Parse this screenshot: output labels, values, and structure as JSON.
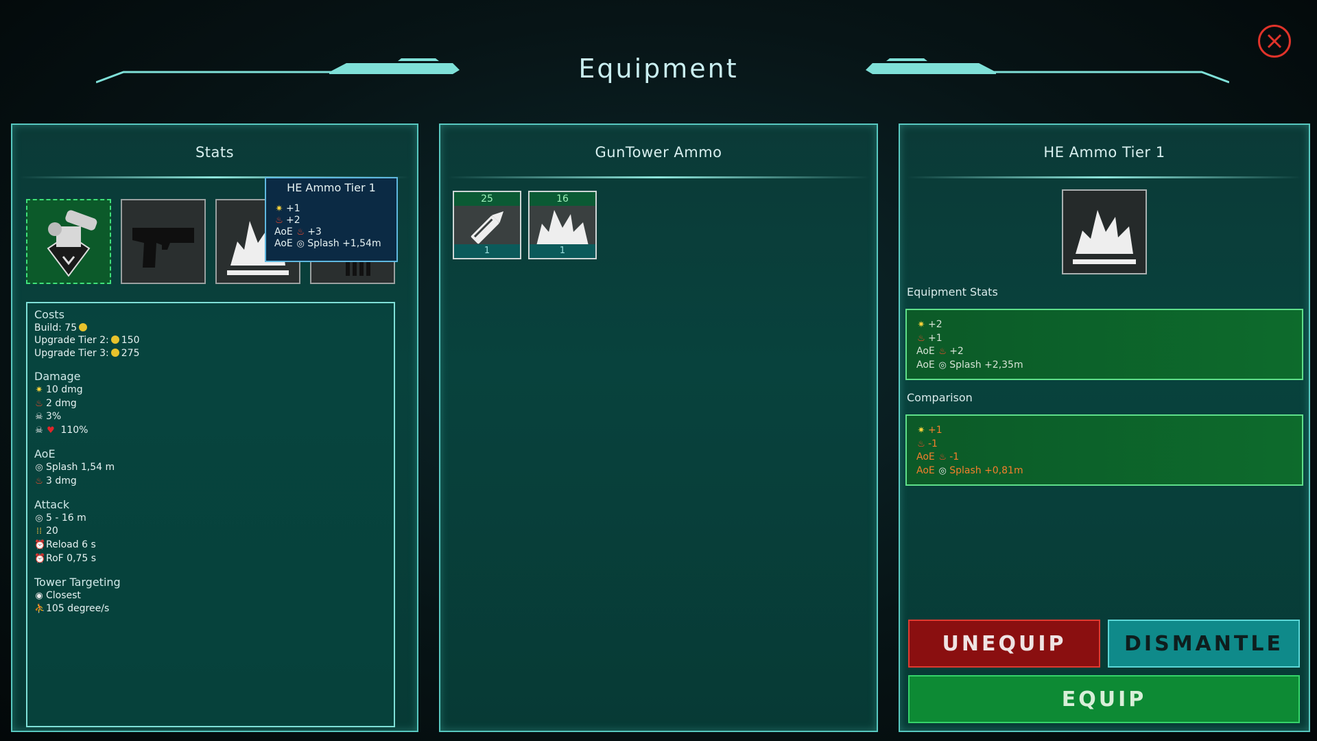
{
  "header": {
    "title": "Equipment"
  },
  "left_panel": {
    "title": "Stats",
    "slots": [
      {
        "icon": "gun-tower-icon",
        "active": true
      },
      {
        "icon": "pistol-icon"
      },
      {
        "icon": "explosion-icon"
      },
      {
        "icon": "bullets-icon"
      }
    ],
    "stats": {
      "costs": {
        "heading": "Costs",
        "build": "Build: 75",
        "upgrade2": "Upgrade Tier 2:",
        "upgrade2_val": "150",
        "upgrade3": "Upgrade Tier 3:",
        "upgrade3_val": "275"
      },
      "damage": {
        "heading": "Damage",
        "sun": "10 dmg",
        "fire": "2 dmg",
        "crit": "3%",
        "crit_mult": "110%"
      },
      "aoe": {
        "heading": "AoE",
        "splash": "Splash 1,54 m",
        "fire": "3 dmg"
      },
      "attack": {
        "heading": "Attack",
        "range": "5 - 16 m",
        "ammo": "20",
        "reload": "Reload 6 s",
        "rof": "RoF 0,75 s"
      },
      "targeting": {
        "heading": "Tower Targeting",
        "mode": "Closest",
        "rotation": "105 degree/s"
      }
    }
  },
  "tooltip": {
    "title": "HE Ammo Tier 1",
    "line1": "+1",
    "line2": "+2",
    "line3_prefix": "AoE",
    "line3_val": "+3",
    "line4_prefix": "AoE",
    "line4_val": "Splash +1,54m"
  },
  "middle_panel": {
    "title": "GunTower Ammo",
    "items": [
      {
        "icon": "bullet-icon",
        "top": "25",
        "bottom": "1"
      },
      {
        "icon": "explosion-icon",
        "top": "16",
        "bottom": "1"
      }
    ]
  },
  "right_panel": {
    "title": "HE Ammo Tier 1",
    "equipment_stats_label": "Equipment Stats",
    "equipment_stats": {
      "sun": "+2",
      "fire": "+1",
      "aoe_prefix": "AoE",
      "aoe_fire": "+2",
      "aoe_splash": "Splash +2,35m"
    },
    "comparison_label": "Comparison",
    "comparison": {
      "sun": "+1",
      "fire": "-1",
      "aoe_prefix": "AoE",
      "aoe_fire": "-1",
      "aoe_splash": "Splash +0,81m"
    },
    "buttons": {
      "unequip": "UNEQUIP",
      "dismantle": "DISMANTLE",
      "equip": "EQUIP"
    }
  },
  "colors": {
    "panel_border": "#58c8c0",
    "close": "#e0332a",
    "unequip": "#8a0f10",
    "dismantle": "#0f8a8a",
    "equip": "#0d8a34",
    "comparison_text": "#f47f2c"
  }
}
